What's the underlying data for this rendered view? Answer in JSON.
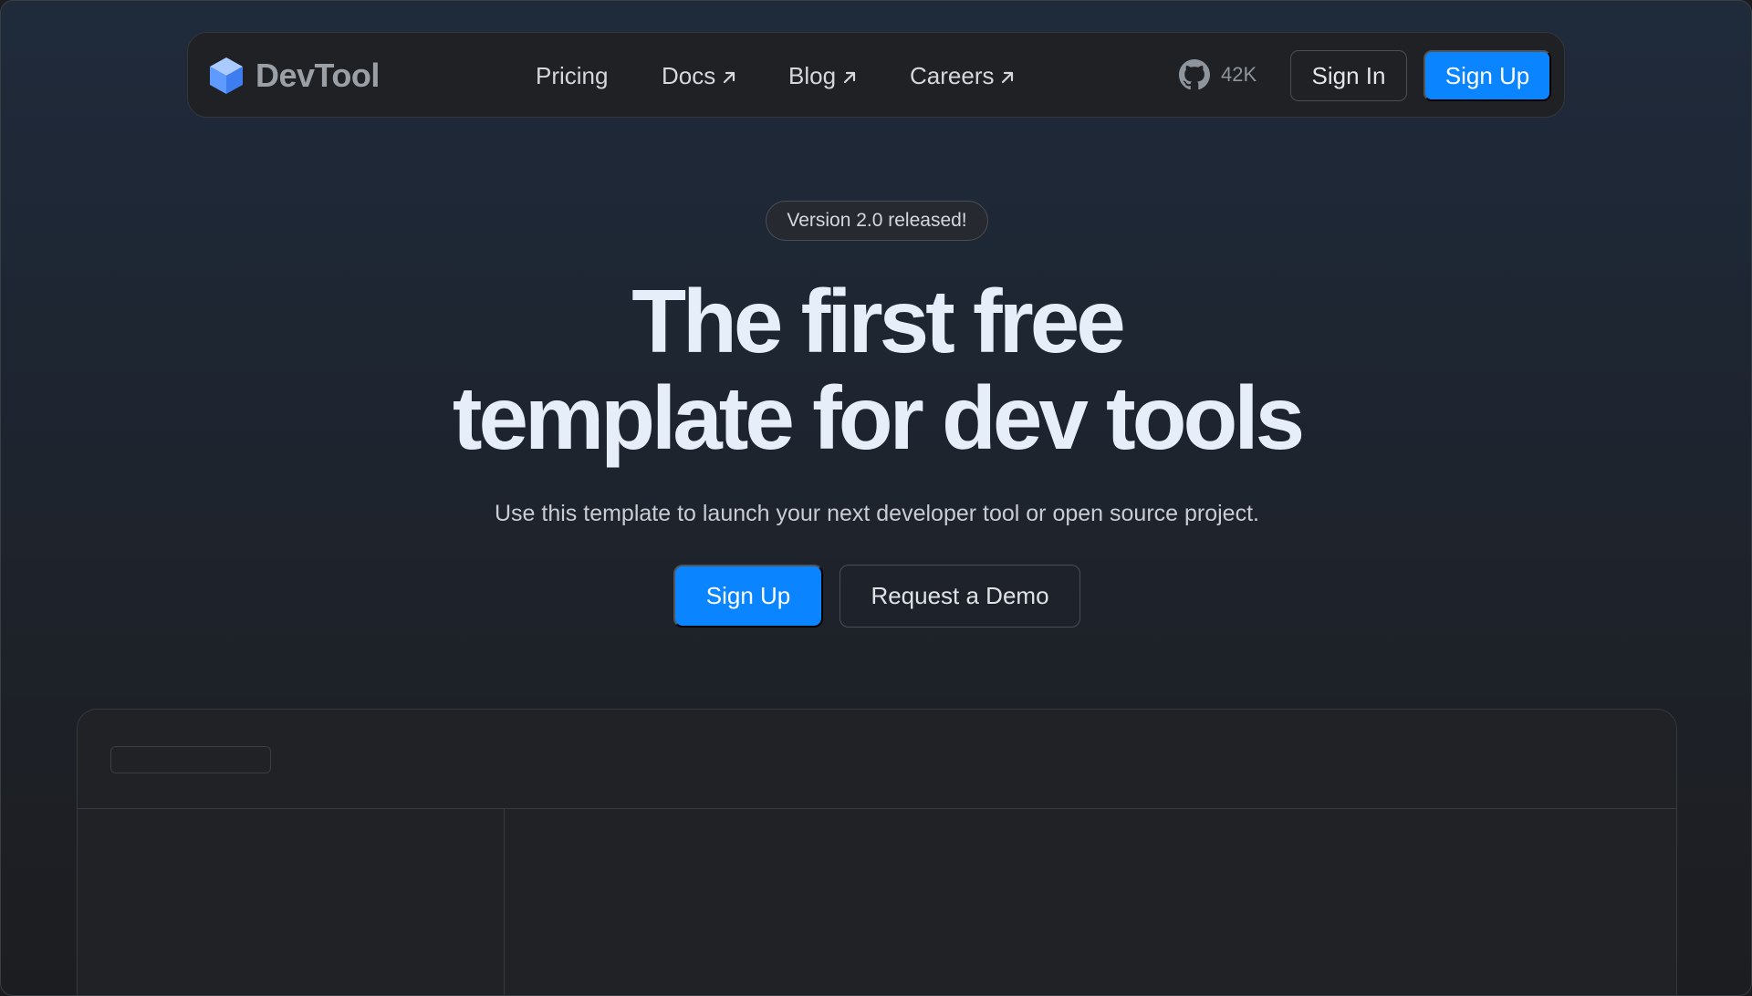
{
  "nav": {
    "brand": "DevTool",
    "links": [
      {
        "label": "Pricing",
        "external": false
      },
      {
        "label": "Docs",
        "external": true
      },
      {
        "label": "Blog",
        "external": true
      },
      {
        "label": "Careers",
        "external": true
      }
    ],
    "github_count": "42K",
    "signin_label": "Sign In",
    "signup_label": "Sign Up"
  },
  "hero": {
    "badge": "Version 2.0 released!",
    "headline_line1": "The first free",
    "headline_line2": "template for dev tools",
    "subhead": "Use this template to launch your next developer tool or open source project.",
    "primary_cta": "Sign Up",
    "secondary_cta": "Request a Demo"
  },
  "colors": {
    "accent": "#0a84ff",
    "headline": "#e6eef9",
    "brand_icon": "#6fa8ff"
  },
  "icons": {
    "brand": "cube-icon",
    "external": "arrow-up-right-icon",
    "github": "github-icon"
  }
}
